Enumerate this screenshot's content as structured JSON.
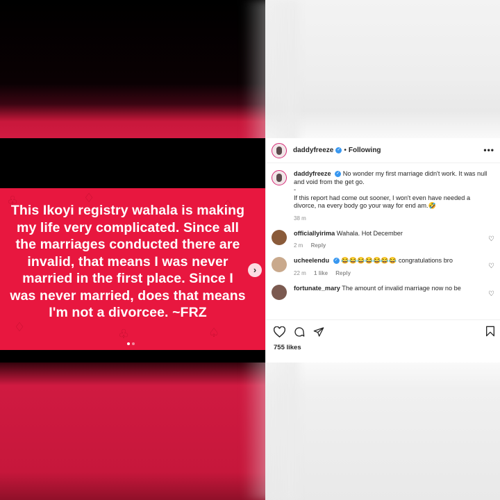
{
  "post": {
    "quote": "This Ikoyi registry wahala is making my life very complicated. Since all the marriages conducted there are invalid, that means I was never married in the first place. Since I was never married, does that means I'm not a divorcee. ~FRZ",
    "username": "daddyfreeze",
    "separator": "•",
    "follow_status": "Following",
    "more": "•••",
    "likes": "755 likes"
  },
  "caption": {
    "username": "daddyfreeze",
    "line1": "No wonder my first marriage didn't work. It was null and void from the get go.",
    "dash": "-",
    "line2": "If this report had come out sooner, I won't even have needed a divorce, na every body go your way for end am.",
    "emoji": "🤣",
    "time": "38 m"
  },
  "comments": [
    {
      "username": "officiallyirima",
      "text": "Wahala. Hot December",
      "time": "2 m",
      "likes": "",
      "reply": "Reply"
    },
    {
      "username": "ucheelendu",
      "emojis": "😂😂😂😂😂😂😂",
      "text": "congratulations bro",
      "time": "22 m",
      "likes": "1 like",
      "reply": "Reply"
    },
    {
      "username": "fortunate_mary",
      "text": "The amount of invalid marriage now no be",
      "time": "",
      "likes": "",
      "reply": ""
    }
  ],
  "icons": [
    "heart-icon",
    "comment-icon",
    "share-icon",
    "bookmark-icon",
    "chevron-right-icon",
    "more-icon",
    "verified-icon"
  ],
  "colors": {
    "card": "#e8173f",
    "verified": "#3897f0",
    "text": "#262626",
    "muted": "#8e8e8e"
  }
}
